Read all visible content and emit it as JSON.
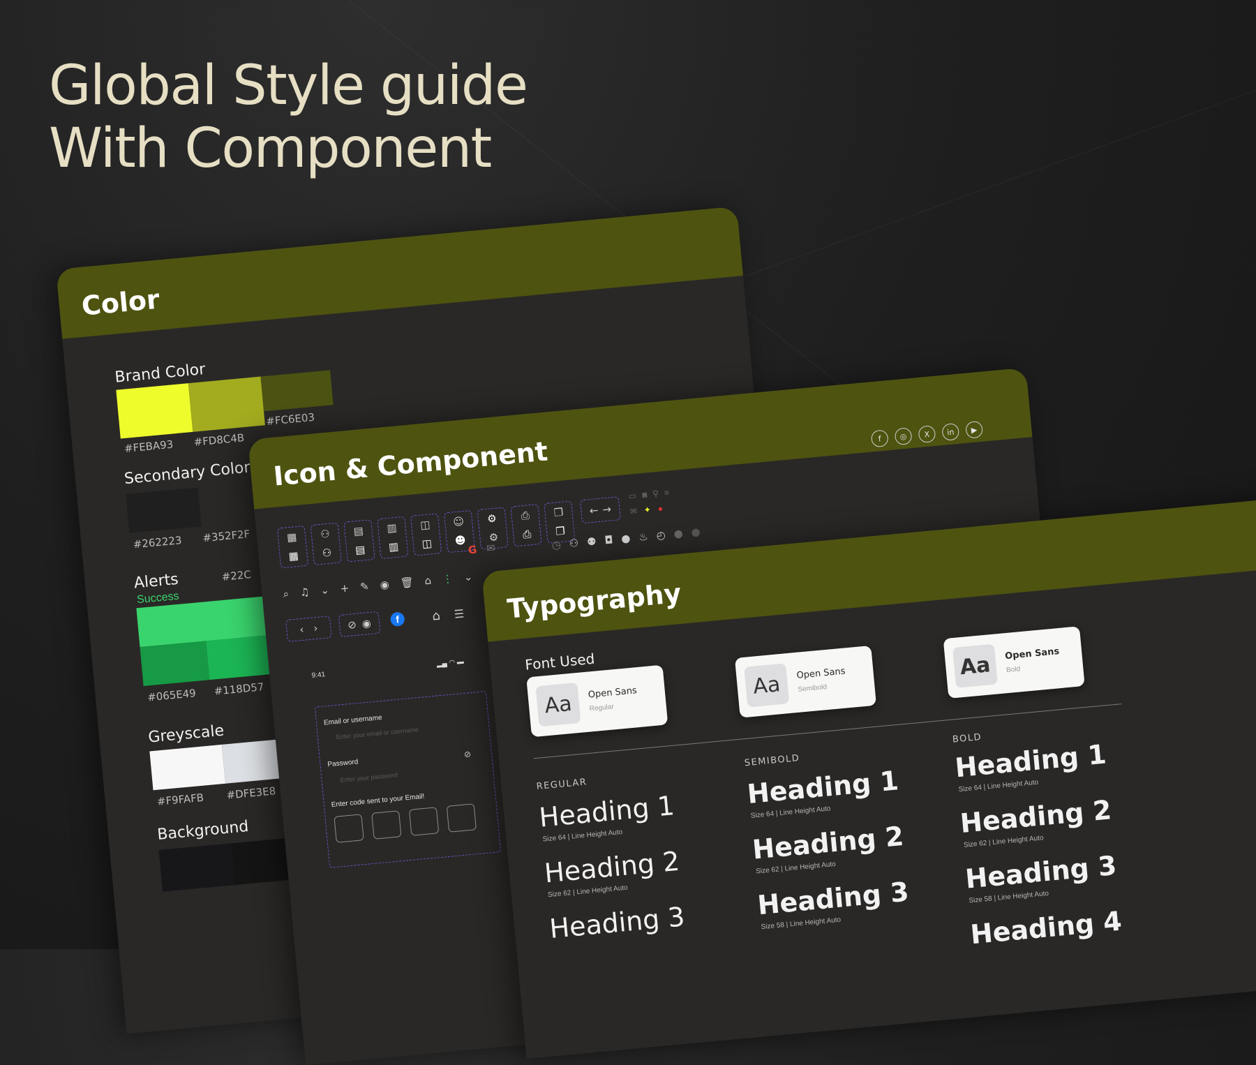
{
  "hero": {
    "line1": "Global Style guide",
    "line2": "With Component"
  },
  "color_card": {
    "title": "Color",
    "brand": {
      "label": "Brand Color",
      "swatches": [
        {
          "hex": "#FEBA93",
          "color": "#eefc2c"
        },
        {
          "hex": "#FD8C4B",
          "color": "#a3ac1f"
        },
        {
          "hex": "#FC6E03",
          "color": "#4c5312"
        }
      ]
    },
    "secondary": {
      "label": "Secondary Color",
      "swatches": [
        {
          "hex": "#262223",
          "color": "#1f1f1f"
        },
        {
          "hex": "#352F2F",
          "color": "#2a2826"
        }
      ]
    },
    "alerts": {
      "label": "Alerts",
      "sub": "Success",
      "hex_top": "#22C",
      "swatches": [
        {
          "hex": "#065E49",
          "color": "#169a45"
        },
        {
          "hex": "#118D57",
          "color": "#1cb554"
        }
      ],
      "main_color": "#3ad46e"
    },
    "greyscale": {
      "label": "Greyscale",
      "swatches": [
        {
          "hex": "#F9FAFB",
          "color": "#f7f7f8"
        },
        {
          "hex": "#DFE3E8",
          "color": "#dcdfe3"
        }
      ]
    },
    "background": {
      "label": "Background",
      "swatches": [
        {
          "color": "#17171a"
        },
        {
          "color": "#141414"
        }
      ]
    }
  },
  "icon_card": {
    "title": "Icon & Component",
    "social_icons": [
      "f",
      "◎",
      "X",
      "in",
      "▶"
    ],
    "login": {
      "time": "9:41",
      "email_label": "Email or username",
      "email_placeholder": "Enter your email or username",
      "password_label": "Password",
      "password_placeholder": "Enter your password",
      "otp_label": "Enter code sent to your Email!"
    }
  },
  "typo_card": {
    "title": "Typography",
    "font_used": "Font Used",
    "fonts": [
      {
        "aa": "Aa",
        "name": "Open Sans",
        "weight": "Regular"
      },
      {
        "aa": "Aa",
        "name": "Open Sans",
        "weight": "Semibold"
      },
      {
        "aa": "Aa",
        "name": "Open Sans",
        "weight": "Bold"
      }
    ],
    "columns": [
      {
        "label": "REGULAR",
        "items": [
          {
            "text": "Heading 1",
            "meta": "Size 64 | Line Height Auto"
          },
          {
            "text": "Heading 2",
            "meta": "Size 62 | Line Height Auto"
          },
          {
            "text": "Heading 3",
            "meta": ""
          }
        ]
      },
      {
        "label": "SEMIBOLD",
        "items": [
          {
            "text": "Heading 1",
            "meta": "Size 64 | Line Height Auto"
          },
          {
            "text": "Heading 2",
            "meta": "Size 62 | Line Height Auto"
          },
          {
            "text": "Heading 3",
            "meta": "Size 58 | Line Height Auto"
          }
        ]
      },
      {
        "label": "BOLD",
        "items": [
          {
            "text": "Heading 1",
            "meta": "Size 64 | Line Height Auto"
          },
          {
            "text": "Heading 2",
            "meta": "Size 62 | Line Height Auto"
          },
          {
            "text": "Heading 3",
            "meta": "Size 58 | Line Height Auto"
          },
          {
            "text": "Heading 4",
            "meta": ""
          }
        ]
      }
    ]
  }
}
